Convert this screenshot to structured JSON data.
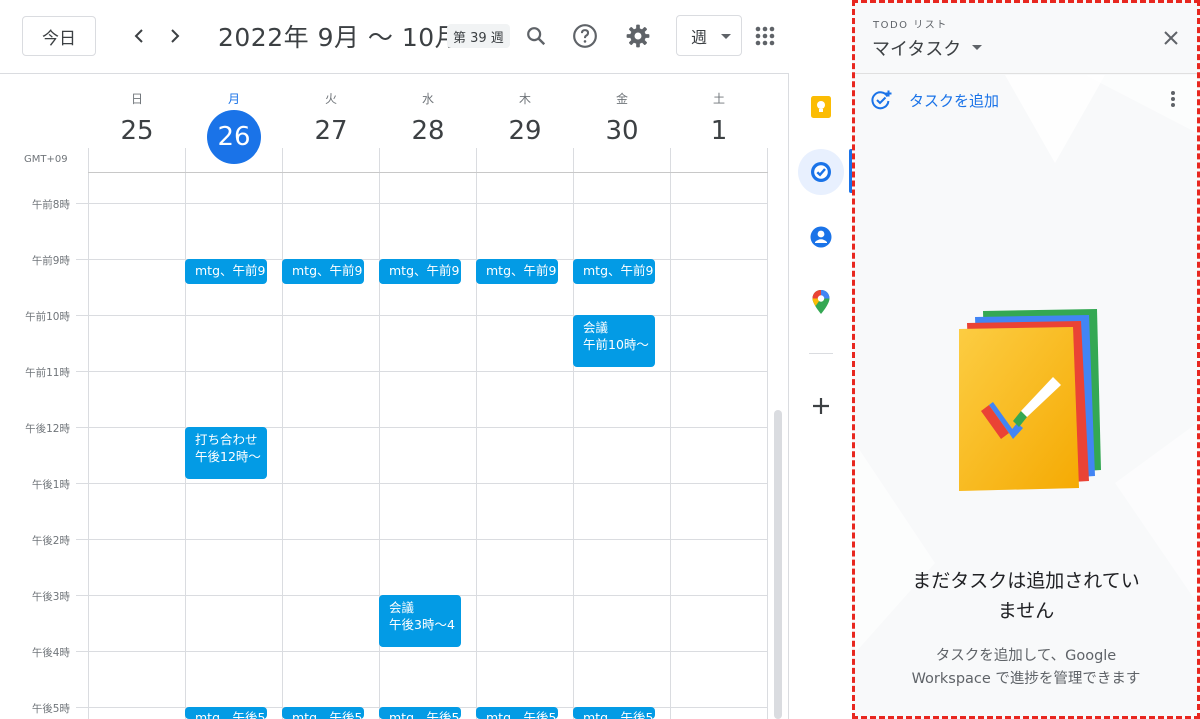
{
  "header": {
    "today_label": "今日",
    "date_range": "2022年 9月 〜 10月",
    "week_badge": "第 39 週",
    "view_label": "週",
    "icons": [
      "chevron-left-icon",
      "chevron-right-icon",
      "search-icon",
      "help-icon",
      "gear-icon",
      "apps-grid-icon"
    ]
  },
  "calendar": {
    "timezone": "GMT+09",
    "days": [
      {
        "name": "日",
        "num": "25"
      },
      {
        "name": "月",
        "num": "26"
      },
      {
        "name": "火",
        "num": "27"
      },
      {
        "name": "水",
        "num": "28"
      },
      {
        "name": "木",
        "num": "29"
      },
      {
        "name": "金",
        "num": "30"
      },
      {
        "name": "土",
        "num": "1"
      }
    ],
    "hours": [
      "午前8時",
      "午前9時",
      "午前10時",
      "午前11時",
      "午後12時",
      "午後1時",
      "午後2時",
      "午後3時",
      "午後4時",
      "午後5時"
    ],
    "events": [
      {
        "title": "mtg、午前9",
        "time": ""
      },
      {
        "title": "mtg、午前9",
        "time": ""
      },
      {
        "title": "mtg、午前9",
        "time": ""
      },
      {
        "title": "mtg、午前9",
        "time": ""
      },
      {
        "title": "mtg、午前9",
        "time": ""
      },
      {
        "title": "会議",
        "time": "午前10時〜"
      },
      {
        "title": "打ち合わせ",
        "time": "午後12時〜"
      },
      {
        "title": "会議",
        "time": "午後3時〜4"
      },
      {
        "title": "mtg、午後5",
        "time": ""
      },
      {
        "title": "mtg、午後5",
        "time": ""
      },
      {
        "title": "mtg、午後5",
        "time": ""
      },
      {
        "title": "mtg、午後5",
        "time": ""
      },
      {
        "title": "mtg、午後5",
        "time": ""
      }
    ],
    "event_color": "#039be5",
    "today_color": "#1a73e8"
  },
  "side_rail": {
    "icons": [
      "keep-icon",
      "tasks-icon",
      "contacts-icon",
      "maps-icon",
      "add-icon"
    ]
  },
  "tasks_panel": {
    "todo_label": "TODO リスト",
    "list_name": "マイタスク",
    "add_task_label": "タスクを追加",
    "empty_title_line1": "まだタスクは追加されてい",
    "empty_title_line2": "ません",
    "empty_sub_line1": "タスクを追加して、Google",
    "empty_sub_line2": "Workspace で進捗を管理できます",
    "highlight_color": "#e8271f"
  }
}
